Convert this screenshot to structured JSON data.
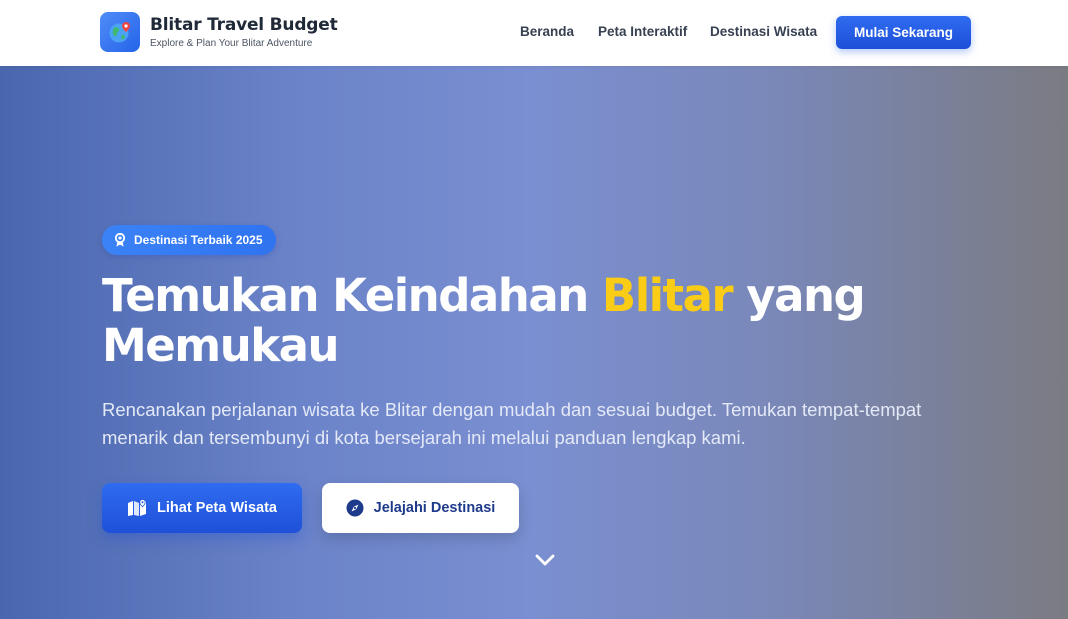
{
  "brand": {
    "title": "Blitar Travel Budget",
    "tagline": "Explore & Plan Your Blitar Adventure",
    "logo_icon": "globe-pin-icon"
  },
  "nav": {
    "links": [
      "Beranda",
      "Peta Interaktif",
      "Destinasi Wisata"
    ],
    "cta_label": "Mulai Sekarang"
  },
  "hero": {
    "badge": "Destinasi Terbaik 2025",
    "badge_icon": "award-icon",
    "title_before": "Temukan Keindahan ",
    "title_highlight": "Blitar",
    "title_after": " yang Memukau",
    "description": "Rencanakan perjalanan wisata ke Blitar dengan mudah dan sesuai budget. Temukan tempat-tempat menarik dan tersembunyi di kota bersejarah ini melalui panduan lengkap kami.",
    "primary_button": "Lihat Peta Wisata",
    "primary_icon": "map-icon",
    "secondary_button": "Jelajahi Destinasi",
    "secondary_icon": "compass-icon",
    "scroll_icon": "chevron-down-icon"
  },
  "colors": {
    "accent": "#2563eb",
    "highlight": "#facc15",
    "hero_gradient_start": "#4a67ad",
    "hero_gradient_end": "#7b7b82"
  }
}
